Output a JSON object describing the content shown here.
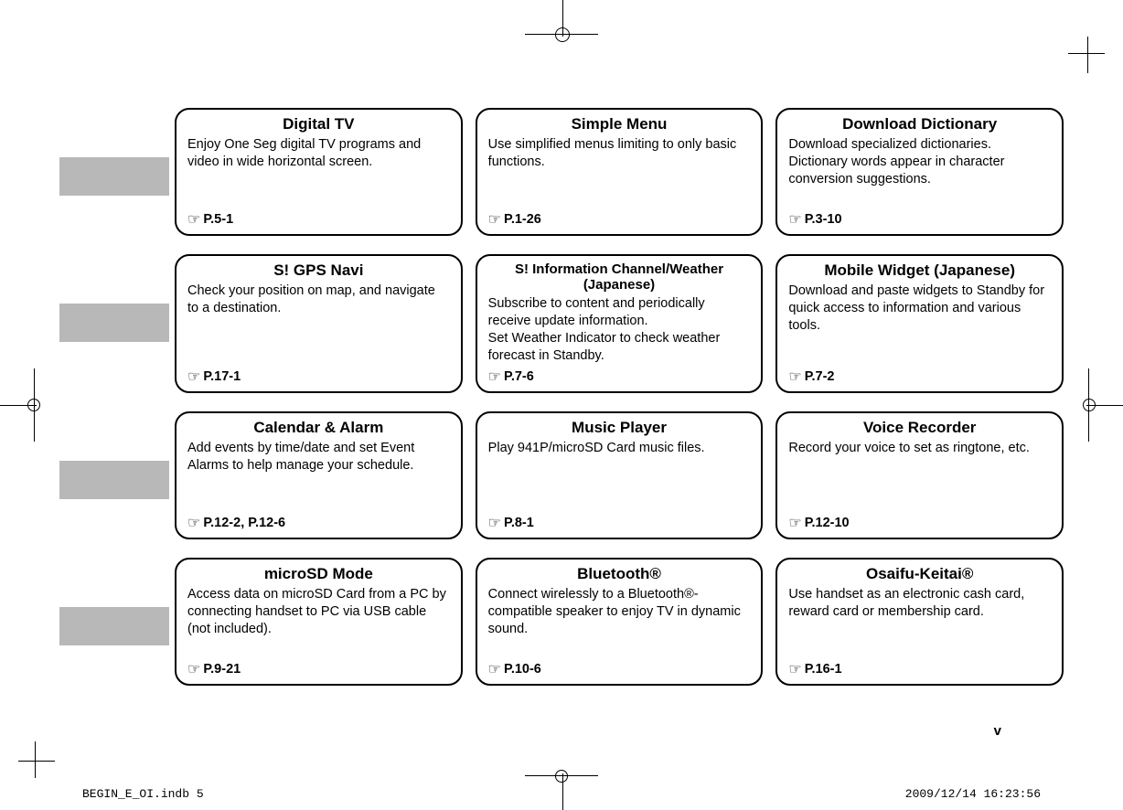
{
  "rows": [
    {
      "cards": [
        {
          "title": "Digital TV",
          "desc": "Enjoy One Seg digital TV programs and video in wide horizontal screen.",
          "ref": "P.5-1"
        },
        {
          "title": "Simple Menu",
          "desc": "Use simplified menus limiting to only basic functions.",
          "ref": "P.1-26"
        },
        {
          "title": "Download Dictionary",
          "desc": "Download specialized dictionaries. Dictionary words appear in character conversion suggestions.",
          "ref": "P.3-10"
        }
      ]
    },
    {
      "cards": [
        {
          "title": "S! GPS Navi",
          "desc": "Check your position on map, and navigate to a destination.",
          "ref": "P.17-1"
        },
        {
          "title": "S! Information Channel/Weather (Japanese)",
          "desc": "Subscribe to content and periodically receive update information.\nSet Weather Indicator to check weather forecast in Standby.",
          "ref": "P.7-6"
        },
        {
          "title": "Mobile Widget (Japanese)",
          "desc": "Download and paste widgets to Standby for quick access to information and various tools.",
          "ref": "P.7-2"
        }
      ]
    },
    {
      "cards": [
        {
          "title": "Calendar & Alarm",
          "desc": "Add events by time/date and set Event Alarms to help manage your schedule.",
          "ref": "P.12-2, P.12-6"
        },
        {
          "title": "Music Player",
          "desc": "Play 941P/microSD Card music files.",
          "ref": "P.8-1"
        },
        {
          "title": "Voice Recorder",
          "desc": "Record your voice to set as ringtone, etc.",
          "ref": "P.12-10"
        }
      ]
    },
    {
      "cards": [
        {
          "title": "microSD Mode",
          "desc": "Access data on microSD Card from a PC by connecting handset to PC via USB cable (not included).",
          "ref": "P.9-21"
        },
        {
          "title": "Bluetooth®",
          "desc": "Connect wirelessly to a Bluetooth®-compatible speaker to enjoy TV in dynamic sound.",
          "ref": "P.10-6"
        },
        {
          "title": "Osaifu-Keitai®",
          "desc": "Use handset as an electronic cash card, reward card or membership card.",
          "ref": "P.16-1"
        }
      ]
    }
  ],
  "page_number": "v",
  "footer_left": "BEGIN_E_OI.indb   5",
  "footer_right": "2009/12/14   16:23:56",
  "hand_icon": "☞"
}
